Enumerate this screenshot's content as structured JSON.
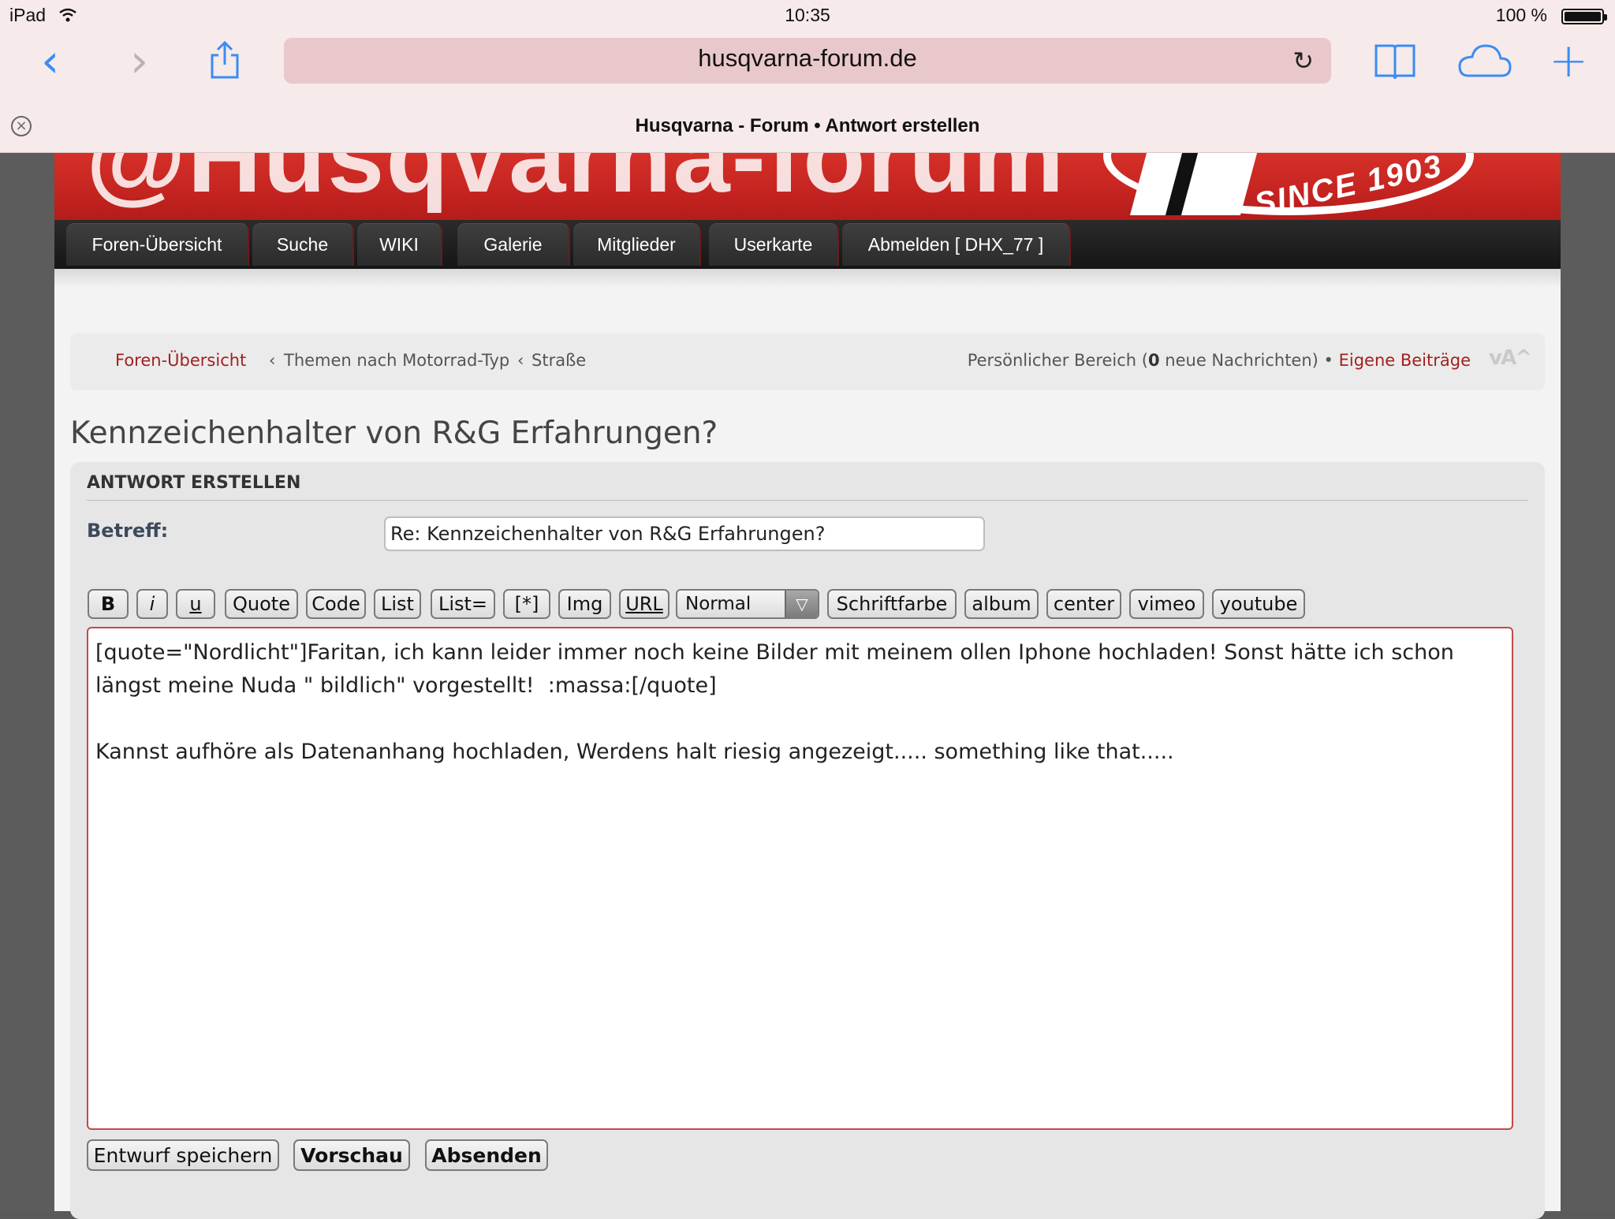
{
  "status_bar": {
    "device": "iPad",
    "time": "10:35",
    "battery_text": "100 %",
    "battery_level": 1.0
  },
  "browser": {
    "url": "husqvarna-forum.de",
    "tab_title": "Husqvarna - Forum • Antwort erstellen",
    "accent_color": "#3b8cf2",
    "icons": [
      "back-icon",
      "forward-icon",
      "share-icon",
      "reload-icon",
      "bookmarks-icon",
      "cloud-icon",
      "new-tab-icon",
      "close-icon"
    ]
  },
  "nav": {
    "tabs": [
      "Foren-Übersicht",
      "Suche",
      "WIKI",
      "Galerie",
      "Mitglieder",
      "Userkarte",
      "Abmelden [ DHX_77 ]"
    ]
  },
  "breadcrumb": {
    "home": "Foren-Übersicht",
    "separator": "‹",
    "themen": "Themen nach Motorrad-Typ",
    "strasse": "Straße",
    "personal_prefix": "Persönlicher Bereich (",
    "new_messages": "0",
    "personal_suffix": " neue Nachrichten) • ",
    "own_posts": "Eigene Beiträge",
    "font_size_glyph": "vA^"
  },
  "topic": {
    "title": "Kennzeichenhalter von R&G Erfahrungen?"
  },
  "form": {
    "panel_title": "ANTWORT ERSTELLEN",
    "subject_label": "Betreff:",
    "subject_value": "Re: Kennzeichenhalter von R&G Erfahrungen?",
    "toolbar": {
      "bold": "B",
      "italic": "i",
      "underline": "u",
      "quote": "Quote",
      "code": "Code",
      "list": "List",
      "list_eq": "List=",
      "list_item": "[*]",
      "img": "Img",
      "url": "URL",
      "size_selected": "Normal",
      "color": "Schriftfarbe",
      "album": "album",
      "center": "center",
      "vimeo": "vimeo",
      "youtube": "youtube"
    },
    "message": "[quote=\"Nordlicht\"]Faritan, ich kann leider immer noch keine Bilder mit meinem ollen Iphone hochladen! Sonst hätte ich schon längst meine Nuda \" bildlich\" vorgestellt!  :massa:[/quote]\n\nKannst aufhöre als Datenanhang hochladen, Werdens halt riesig angezeigt..... something like that.....",
    "actions": {
      "save_draft": "Entwurf speichern",
      "preview": "Vorschau",
      "submit": "Absenden"
    }
  },
  "colors": {
    "brand_red": "#c42420",
    "link_red": "#a32020",
    "nav_dark": "#222222"
  }
}
